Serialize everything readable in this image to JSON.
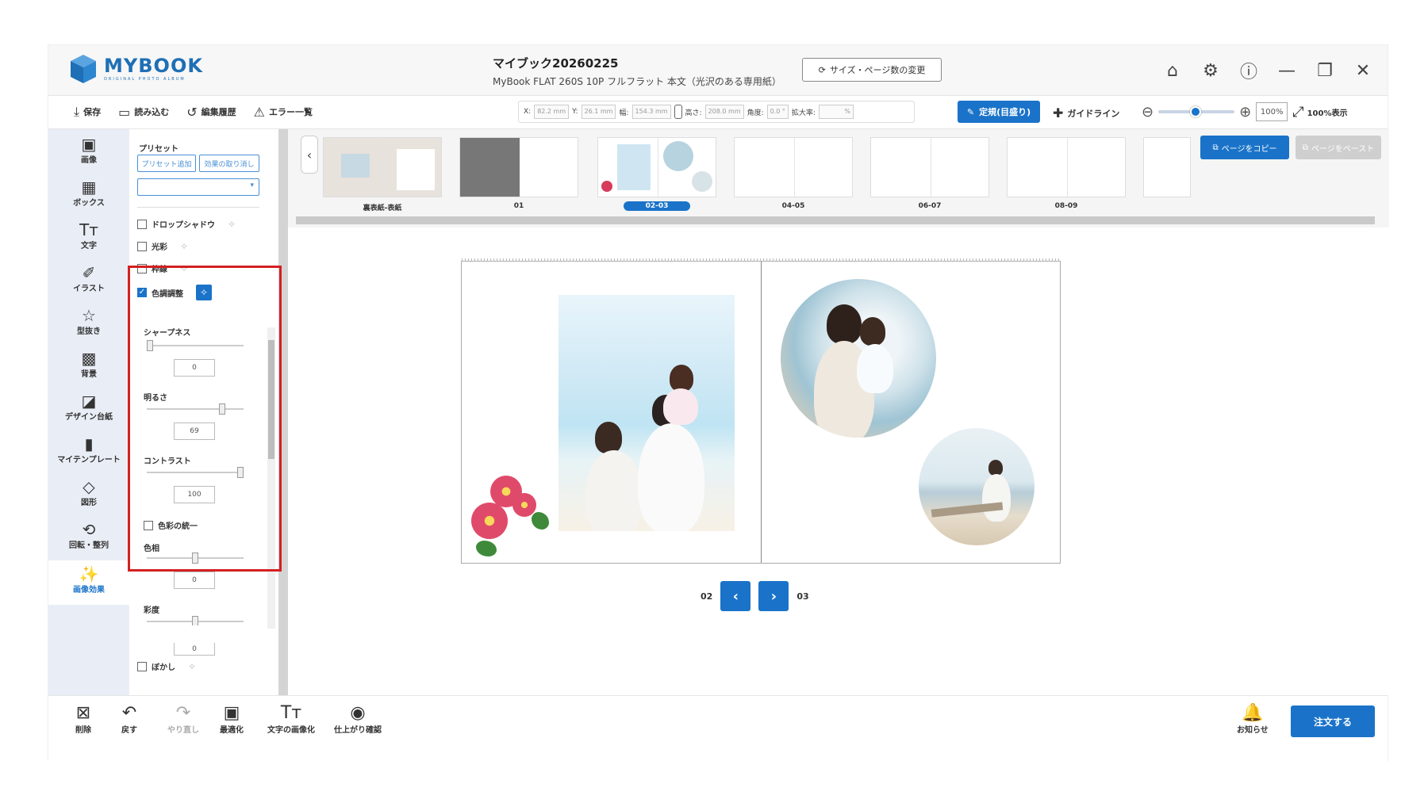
{
  "header": {
    "logo_text": "MYBOOK",
    "logo_sub": "ORIGINAL PHOTO ALBUM",
    "title": "マイブック20260225",
    "subtitle": "MyBook FLAT 260S 10P フルフラット 本文（光沢のある専用紙）",
    "size_button": "サイズ・ページ数の変更"
  },
  "toolbar": {
    "save": "保存",
    "load": "読み込む",
    "history": "編集履歴",
    "errors": "エラー一覧",
    "x_label": "X:",
    "x_val": "82.2 mm",
    "y_label": "Y:",
    "y_val": "26.1 mm",
    "w_label": "幅:",
    "w_val": "154.3 mm",
    "h_label": "高さ:",
    "h_val": "208.0 mm",
    "angle_label": "角度:",
    "angle_val": "0.0 °",
    "scale_label": "拡大率:",
    "scale_val": "%",
    "ruler": "定規(目盛り)",
    "guideline": "ガイドライン",
    "zoom_pct": "100%",
    "zoom_full": "100%表示"
  },
  "rail": [
    "画像",
    "ボックス",
    "文字",
    "イラスト",
    "型抜き",
    "背景",
    "デザイン台紙",
    "マイテンプレート",
    "図形",
    "回転・整列",
    "画像効果"
  ],
  "panel": {
    "preset_title": "プリセット",
    "preset_add": "プリセット追加",
    "effect_remove": "効果の取り消し",
    "drop_shadow": "ドロップシャドウ",
    "glow": "光彩",
    "border": "枠線",
    "color_adjust": "色調調整",
    "sharpness": "シャープネス",
    "sharpness_val": "0",
    "brightness": "明るさ",
    "brightness_val": "69",
    "contrast": "コントラスト",
    "contrast_val": "100",
    "unify_color": "色彩の統一",
    "hue": "色相",
    "hue_val": "0",
    "saturation": "彩度",
    "saturation_val": "0",
    "blur": "ぼかし"
  },
  "sliders": {
    "sharpness": 0.0,
    "brightness": 0.8,
    "contrast": 1.0,
    "hue": 0.5,
    "saturation": 0.5
  },
  "pages": {
    "thumbs": [
      "裏表紙-表紙",
      "01",
      "02-03",
      "04-05",
      "06-07",
      "08-09"
    ],
    "copy": "ページをコピー",
    "paste": "ページをペースト",
    "current_left": "02",
    "current_right": "03"
  },
  "bottom": {
    "delete": "削除",
    "undo": "戻す",
    "redo": "やり直し",
    "optimize": "最適化",
    "text_to_image": "文字の画像化",
    "preview": "仕上がり確認",
    "notice": "お知らせ",
    "order": "注文する"
  },
  "colors": {
    "accent": "#1a73c9",
    "highlight": "#d42020"
  }
}
